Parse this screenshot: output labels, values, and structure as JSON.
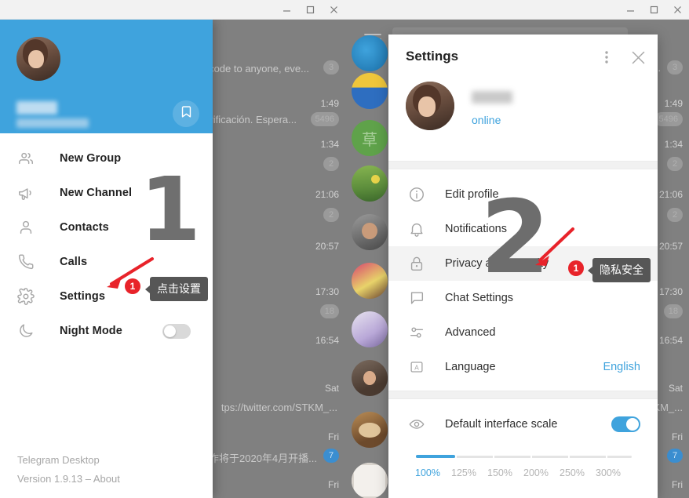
{
  "window_controls": {
    "minimize": "minimize-icon",
    "maximize": "maximize-icon",
    "close": "close-icon"
  },
  "left_window": {
    "sidebar": {
      "profile": {
        "name_hidden": true,
        "phone_hidden": true,
        "saved_messages_icon": "bookmark-icon"
      },
      "items": [
        {
          "label": "New Group",
          "icon": "people-icon"
        },
        {
          "label": "New Channel",
          "icon": "megaphone-icon"
        },
        {
          "label": "Contacts",
          "icon": "person-icon"
        },
        {
          "label": "Calls",
          "icon": "phone-icon"
        },
        {
          "label": "Settings",
          "icon": "gear-icon"
        },
        {
          "label": "Night Mode",
          "icon": "moon-icon",
          "toggle": "off"
        }
      ],
      "footer": {
        "app_name": "Telegram Desktop",
        "version_line": "Version 1.9.13 – About",
        "version_text": "Version 1.9.13 – ",
        "about_link": "About"
      }
    },
    "annotation": {
      "step_number": "1",
      "badge": "1",
      "tooltip": "点击设置"
    },
    "chat_list": [
      {
        "snippet": "code to anyone, eve...",
        "badge": "3"
      },
      {
        "time": "1:49"
      },
      {
        "snippet": "rificación. Espera...",
        "badge": "5496"
      },
      {
        "time": "1:34",
        "badge": "2"
      },
      {
        "time": "21:06",
        "badge": "2"
      },
      {
        "time": "20:57"
      },
      {
        "time": "17:30",
        "badge": "18"
      },
      {
        "time": "16:54"
      },
      {
        "time": "Sat",
        "snippet": "tps://twitter.com/STKM_..."
      },
      {
        "time": "Fri",
        "snippet": "作将于2020年4月开播...",
        "badge": "7"
      },
      {
        "time": "Fri"
      }
    ]
  },
  "right_window": {
    "menu_icon": "hamburger-icon",
    "dialog": {
      "title": "Settings",
      "more_icon": "more-vertical-icon",
      "close_icon": "close-icon",
      "profile": {
        "name_hidden": true,
        "status": "online"
      },
      "menu": [
        {
          "label": "Edit profile",
          "icon": "info-circle-icon"
        },
        {
          "label": "Notifications",
          "icon": "bell-icon"
        },
        {
          "label": "Privacy and Security",
          "icon": "lock-icon",
          "highlighted": true
        },
        {
          "label": "Chat Settings",
          "icon": "chat-bubble-icon"
        },
        {
          "label": "Advanced",
          "icon": "sliders-icon"
        },
        {
          "label": "Language",
          "icon": "letter-a-icon",
          "value": "English"
        }
      ],
      "interface_scale": {
        "icon": "eye-icon",
        "label": "Default interface scale",
        "toggle": "on",
        "current": "100%",
        "options": [
          "100%",
          "125%",
          "150%",
          "200%",
          "250%",
          "300%"
        ]
      }
    },
    "annotation": {
      "step_number": "2",
      "badge": "1",
      "tooltip": "隐私安全"
    },
    "chat_list": [
      {
        "time": "1:49"
      },
      {
        "badge": "5496"
      },
      {
        "time": "1:34",
        "badge": "2"
      },
      {
        "time": "21:06",
        "badge": "2"
      },
      {
        "time": "20:57"
      },
      {
        "time": "17:30",
        "badge": "18"
      },
      {
        "time": "16:54"
      },
      {
        "time": "Sat"
      },
      {
        "snippet": "KM_..."
      },
      {
        "time": "Fri",
        "badge": "7"
      },
      {
        "time": "Fri"
      }
    ],
    "first_row_snippet": "e...",
    "first_row_badge": "3"
  },
  "colors": {
    "accent": "#3fa3dd",
    "annotation_red": "#e8232a",
    "tooltip_bg": "#565656",
    "dim_overlay": "#808080"
  }
}
